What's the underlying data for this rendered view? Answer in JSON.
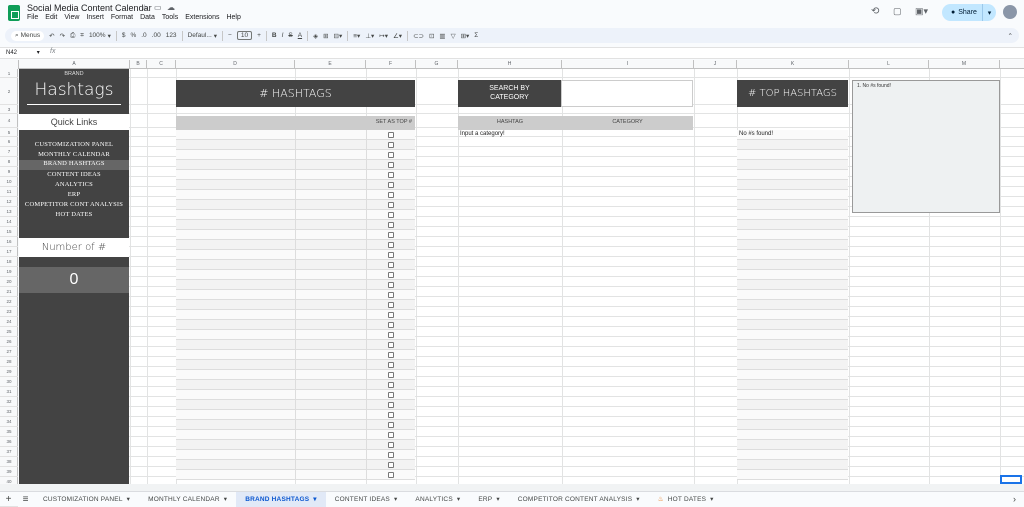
{
  "app": {
    "title": "Social Media Content Calendar",
    "menus": [
      "File",
      "Edit",
      "View",
      "Insert",
      "Format",
      "Data",
      "Tools",
      "Extensions",
      "Help"
    ],
    "share_label": "Share"
  },
  "toolbar": {
    "search_placeholder": "Menus",
    "zoom": "100%",
    "currency": "$",
    "percent": "%",
    "decimal_dec": ".0",
    "decimal_inc": ".00",
    "number_format": "123",
    "font": "Defaul...",
    "font_size": "10",
    "bold": "B",
    "italic": "I",
    "strike": "S",
    "text_color": "A"
  },
  "formula_bar": {
    "cell_ref": "N42",
    "fx": "fx"
  },
  "columns": [
    "A",
    "B",
    "C",
    "D",
    "E",
    "F",
    "G",
    "H",
    "I",
    "J",
    "K",
    "L",
    "M"
  ],
  "rows": [
    "1",
    "2",
    "3",
    "4",
    "5",
    "6",
    "7",
    "8",
    "9",
    "10",
    "11",
    "12",
    "13",
    "14",
    "15",
    "16",
    "17",
    "18",
    "19",
    "20",
    "21",
    "22",
    "23",
    "24",
    "25",
    "26",
    "27",
    "28",
    "29",
    "30",
    "31",
    "32",
    "33",
    "34",
    "35",
    "36",
    "37",
    "38",
    "39",
    "40",
    "41",
    "42"
  ],
  "sheet": {
    "brand_label": "BRAND",
    "title": "Hashtags",
    "quick_links_title": "Quick Links",
    "quick_links": [
      "CUSTOMIZATION PANEL",
      "MONTHLY CALENDAR",
      "BRAND HASHTAGS",
      "CONTENT IDEAS",
      "ANALYTICS",
      "ERP",
      "COMPETITOR CONT ANALYSIS",
      "HOT DATES"
    ],
    "number_label": "Number of #",
    "number_value": "0",
    "hashtags_header": "# HASHTAGS",
    "set_as_top": "SET AS TOP #",
    "search_by_line1": "SEARCH BY",
    "search_by_line2": "CATEGORY",
    "hashtag_col": "HASHTAG",
    "category_col": "CATEGORY",
    "input_category": "Input a category!",
    "top_hashtags_header": "# TOP HASHTAGS",
    "no_found": "No #s found!",
    "notes_text": "1.  No #s found!"
  },
  "sheet_tabs": [
    {
      "label": "CUSTOMIZATION PANEL"
    },
    {
      "label": "MONTHLY CALENDAR"
    },
    {
      "label": "BRAND HASHTAGS"
    },
    {
      "label": "CONTENT IDEAS"
    },
    {
      "label": "ANALYTICS"
    },
    {
      "label": "ERP"
    },
    {
      "label": "COMPETITOR CONTENT ANALYSIS"
    },
    {
      "label": "HOT DATES"
    }
  ],
  "colors": {
    "dark_panel": "#434343",
    "accent_blue": "#0b57d0",
    "share_bg": "#c2e7ff"
  }
}
